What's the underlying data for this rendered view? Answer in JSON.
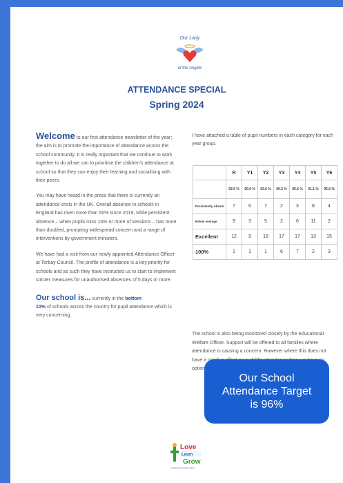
{
  "logo": {
    "top_text": "Our Lady",
    "bottom_text": "of the Angels"
  },
  "title": "ATTENDANCE SPECIAL",
  "subtitle": "Spring 2024",
  "left": {
    "lead_word": "Welcome",
    "p1": "to our first attendance newsletter of the year; the aim is to promote the importance of attendance across the school community. It is really important that we continue to work together to do all we can to prioritise the children's attendance at school so that they can enjoy their learning and socialising with their peers.",
    "p2": "You may have heard in the press that there is currently an attendance crisis in the UK. Overall absence in schools in England has risen more than 50% since 2019, while persistent absence – when pupils miss 10% or more of sessions – has more than doubled, prompting widespread concern and a range of interventions by government ministers.",
    "p3": "We have had a visit from our newly appointed Attendance Officer at Torbay Council. The profile of attendance is a key priority for schools and as such they have instructed us to start to implement stricter measures for unauthorised absences of 5 days or more.",
    "p4_lead": "Our school is...",
    "p4_a": "currently in the",
    "p4_bold1": "bottom",
    "p4_bold2": "10%",
    "p4_b": "of schools across the country for pupil attendance which is very concerning."
  },
  "right": {
    "intro": "I have attached a table of pupil numbers in each category for each year group.",
    "table": {
      "headers": [
        "",
        "R",
        "Y1",
        "Y2",
        "Y3",
        "Y4",
        "Y5",
        "Y6"
      ],
      "percent_row": [
        "",
        "92.5 %",
        "90.9 %",
        "92.6 %",
        "90.3 %",
        "95.6 %",
        "91.1 %",
        "95.6 %"
      ],
      "rows": [
        {
          "label": "Persistently Absent",
          "values": [
            "7",
            "6",
            "7",
            "2",
            "3",
            "8",
            "4"
          ]
        },
        {
          "label": "Below average",
          "values": [
            "9",
            "3",
            "5",
            "2",
            "6",
            "11",
            "2"
          ]
        },
        {
          "label": "Excellent",
          "values": [
            "12",
            "9",
            "16",
            "17",
            "17",
            "13",
            "15"
          ]
        },
        {
          "label": "100%",
          "values": [
            "1",
            "1",
            "1",
            "6",
            "7",
            "2",
            "3"
          ]
        }
      ]
    },
    "monitor": "The school is also being monitored closely by the Educational Welfare Officer. Support will be offered to all families where attendance is causing a concern. However where this does not have a positive effect on a child's attendance then we have no option other than to follow the Local Authority's legal route.",
    "target_line1": "Our School",
    "target_line2": "Attendance Target",
    "target_line3": "is 96%"
  },
  "footer": {
    "l1": "Love",
    "l2": "Learn",
    "l3": "Grow",
    "tag": "Inspired by Gospel values"
  }
}
